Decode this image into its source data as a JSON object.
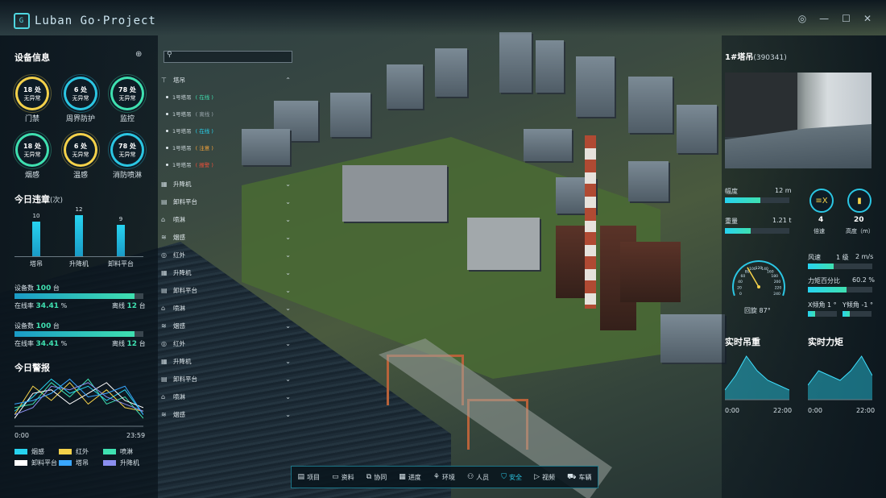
{
  "app": {
    "title": "Luban Go·Project",
    "logo_mark": "G"
  },
  "window_controls": [
    "◎",
    "—",
    "☐",
    "✕"
  ],
  "device_info": {
    "title": "设备信息",
    "stats": [
      {
        "count": "18 处",
        "status": "无异常",
        "label": "门禁",
        "color": "y"
      },
      {
        "count": "6 处",
        "status": "无异常",
        "label": "周界防护",
        "color": "c"
      },
      {
        "count": "78 处",
        "status": "无异常",
        "label": "监控",
        "color": "g"
      },
      {
        "count": "18 处",
        "status": "无异常",
        "label": "烟感",
        "color": "g"
      },
      {
        "count": "6 处",
        "status": "无异常",
        "label": "温感",
        "color": "y"
      },
      {
        "count": "78 处",
        "status": "无异常",
        "label": "消防喷淋",
        "color": "c"
      }
    ]
  },
  "violations": {
    "title": "今日违章",
    "unit": "(次)",
    "chart_data": {
      "type": "bar",
      "categories": [
        "塔吊",
        "升降机",
        "卸料平台"
      ],
      "values": [
        10,
        12,
        9
      ],
      "ylim": [
        0,
        14
      ]
    }
  },
  "device_counts": [
    {
      "label": "设备数",
      "count": "100",
      "unit": "台",
      "online_label": "在线率",
      "online_rate": "34.41",
      "pct": "%",
      "offline_label": "离线",
      "offline": "12",
      "offline_unit": "台",
      "fill": 0.93
    },
    {
      "label": "设备数",
      "count": "100",
      "unit": "台",
      "online_label": "在线率",
      "online_rate": "34.41",
      "pct": "%",
      "offline_label": "离线",
      "offline": "12",
      "offline_unit": "台",
      "fill": 0.93
    }
  ],
  "alarms": {
    "title": "今日警报",
    "x_start": "0:00",
    "x_end": "23:59",
    "chart_data": {
      "type": "line",
      "x": [
        0,
        1,
        2,
        3,
        4,
        5,
        6,
        7
      ],
      "series": [
        {
          "name": "烟感",
          "color": "#27d3f0",
          "values": [
            4,
            8,
            13,
            9,
            11,
            7,
            10,
            3
          ]
        },
        {
          "name": "红外",
          "color": "#f4d14a",
          "values": [
            3,
            11,
            7,
            12,
            6,
            10,
            5,
            4
          ]
        },
        {
          "name": "喷淋",
          "color": "#3fe0b0",
          "values": [
            5,
            6,
            12,
            8,
            13,
            6,
            8,
            2
          ]
        },
        {
          "name": "卸料平台",
          "color": "#ffffff",
          "values": [
            2,
            9,
            10,
            6,
            9,
            12,
            7,
            5
          ]
        },
        {
          "name": "塔吊",
          "color": "#39a7ff",
          "values": [
            6,
            7,
            9,
            13,
            8,
            9,
            11,
            3
          ]
        },
        {
          "name": "升降机",
          "color": "#8b8ff0",
          "values": [
            3,
            5,
            11,
            10,
            12,
            8,
            6,
            4
          ]
        }
      ]
    }
  },
  "search": {
    "placeholder": ""
  },
  "tree": {
    "groups": [
      {
        "icon": "⊤",
        "label": "塔吊",
        "chev": "⌃"
      },
      {
        "icon": "▦",
        "label": "升降机",
        "chev": "⌄"
      },
      {
        "icon": "▤",
        "label": "卸料平台",
        "chev": "⌄"
      },
      {
        "icon": "⌂",
        "label": "喷淋",
        "chev": "⌄"
      },
      {
        "icon": "≋",
        "label": "烟感",
        "chev": "⌄"
      },
      {
        "icon": "◎",
        "label": "红外",
        "chev": "⌄"
      },
      {
        "icon": "▦",
        "label": "升降机",
        "chev": "⌄"
      },
      {
        "icon": "▤",
        "label": "卸料平台",
        "chev": "⌄"
      },
      {
        "icon": "⌂",
        "label": "喷淋",
        "chev": "⌄"
      },
      {
        "icon": "≋",
        "label": "烟感",
        "chev": "⌄"
      },
      {
        "icon": "◎",
        "label": "红外",
        "chev": "⌄"
      },
      {
        "icon": "▦",
        "label": "升降机",
        "chev": "⌄"
      },
      {
        "icon": "▤",
        "label": "卸料平台",
        "chev": "⌄"
      },
      {
        "icon": "⌂",
        "label": "喷淋",
        "chev": "⌄"
      },
      {
        "icon": "≋",
        "label": "烟感",
        "chev": "⌄"
      }
    ],
    "cranes": [
      {
        "name": "1号塔吊",
        "status": "在线",
        "color": "#3fe0b0"
      },
      {
        "name": "1号塔吊",
        "status": "离线",
        "color": "#9aa6ad"
      },
      {
        "name": "1号塔吊",
        "status": "在线",
        "color": "#27d3f0"
      },
      {
        "name": "1号塔吊",
        "status": "注意",
        "color": "#f4a23a"
      },
      {
        "name": "1号塔吊",
        "status": "报警",
        "color": "#f0503a"
      }
    ]
  },
  "crane_panel": {
    "title": "1#塔吊",
    "id": "(390341)",
    "amplitude_label": "幅度",
    "amplitude_value": "12 m",
    "amplitude_fill": 0.55,
    "weight_label": "重量",
    "weight_value": "1.21 t",
    "weight_fill": 0.4,
    "speed_icon": "≡X",
    "speed_value": "4",
    "speed_label": "倍速",
    "height_icon": "▮",
    "height_value": "20",
    "height_label": "高度（m）",
    "rotation_label": "回旋",
    "rotation_value": "87°",
    "wind_label": "风速",
    "wind_level": "1 级",
    "wind_speed": "2 m/s",
    "wind_fill": 0.4,
    "torque_label": "力矩百分比",
    "torque_value": "60.2 %",
    "torque_fill": 0.6,
    "x_tilt_label": "X倾角",
    "x_tilt_value": "1 °",
    "y_tilt_label": "Y倾角",
    "y_tilt_value": "-1 °",
    "tilt_fill_x": 0.25,
    "tilt_fill_y": 0.25,
    "gauge_ticks": [
      "0",
      "20",
      "40",
      "60",
      "80",
      "100",
      "120",
      "140",
      "160",
      "180",
      "200",
      "220",
      "240"
    ]
  },
  "realtime": {
    "load_title": "实时吊重",
    "torque_title": "实时力矩",
    "x_start": "0:00",
    "x_end": "22:00",
    "chart_data": [
      {
        "type": "area",
        "title": "实时吊重",
        "x": [
          0,
          1,
          2,
          3,
          4,
          5,
          6
        ],
        "values": [
          2,
          5,
          9,
          6,
          4,
          3,
          2
        ]
      },
      {
        "type": "area",
        "title": "实时力矩",
        "x": [
          0,
          1,
          2,
          3,
          4,
          5,
          6
        ],
        "values": [
          3,
          6,
          5,
          4,
          6,
          9,
          5
        ]
      }
    ]
  },
  "dock": [
    {
      "icon": "▤",
      "label": "项目",
      "active": false
    },
    {
      "icon": "▭",
      "label": "资料",
      "active": false
    },
    {
      "icon": "⧉",
      "label": "协同",
      "active": false
    },
    {
      "icon": "▦",
      "label": "进度",
      "active": false
    },
    {
      "icon": "⚘",
      "label": "环境",
      "active": false
    },
    {
      "icon": "⚇",
      "label": "人员",
      "active": false
    },
    {
      "icon": "⛉",
      "label": "安全",
      "active": true
    },
    {
      "icon": "▷",
      "label": "视频",
      "active": false
    },
    {
      "icon": "⛟",
      "label": "车辆",
      "active": false
    }
  ]
}
